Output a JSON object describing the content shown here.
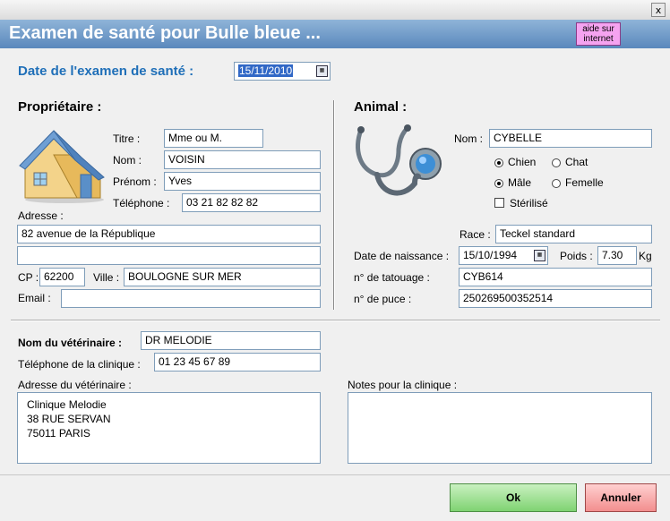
{
  "window": {
    "close_glyph": "x",
    "title": "Examen de santé pour Bulle bleue ...",
    "help_label": "aide sur internet"
  },
  "exam": {
    "date_label": "Date de l'examen de santé :",
    "date_value": "15/11/2010"
  },
  "owner": {
    "section_title": "Propriétaire :",
    "title_label": "Titre :",
    "title_value": "Mme ou M.",
    "name_label": "Nom :",
    "name_value": "VOISIN",
    "firstname_label": "Prénom :",
    "firstname_value": "Yves",
    "phone_label": "Téléphone :",
    "phone_value": "03 21 82 82 82",
    "address_label": "Adresse :",
    "address_line1": "82 avenue de la République",
    "address_line2": "",
    "zip_label": "CP :",
    "zip_value": "62200",
    "city_label": "Ville :",
    "city_value": "BOULOGNE SUR MER",
    "email_label": "Email :",
    "email_value": ""
  },
  "animal": {
    "section_title": "Animal :",
    "name_label": "Nom :",
    "name_value": "CYBELLE",
    "species_options": [
      "Chien",
      "Chat"
    ],
    "species_selected": "Chien",
    "sex_options": [
      "Mâle",
      "Femelle"
    ],
    "sex_selected": "Mâle",
    "sterilized_label": "Stérilisé",
    "sterilized": false,
    "breed_label": "Race :",
    "breed_value": "Teckel standard",
    "birth_label": "Date de naissance :",
    "birth_value": "15/10/1994",
    "weight_label": "Poids :",
    "weight_value": "7.30",
    "weight_unit": "Kg",
    "tattoo_label": "n° de tatouage :",
    "tattoo_value": "CYB614",
    "chip_label": "n° de puce :",
    "chip_value": "250269500352514"
  },
  "vet": {
    "name_label": "Nom du vétérinaire :",
    "name_value": "DR MELODIE",
    "clinic_phone_label": "Téléphone de la clinique :",
    "clinic_phone_value": "01 23 45 67 89",
    "address_label": "Adresse du vétérinaire :",
    "address_lines": [
      "Clinique Melodie",
      "38 RUE SERVAN",
      "75011 PARIS"
    ],
    "notes_label": "Notes pour la clinique :",
    "notes_value": ""
  },
  "buttons": {
    "ok": "Ok",
    "cancel": "Annuler"
  },
  "colors": {
    "header_gradient": [
      "#8fb4d8",
      "#5a88bc"
    ],
    "date_label": "#1f6fb8",
    "ok": "#7fd372",
    "cancel": "#f28e8e",
    "help": "#f5a3f0"
  },
  "icons": {
    "owner": "house-icon",
    "animal": "stethoscope-icon",
    "calendar": "calendar-icon"
  }
}
